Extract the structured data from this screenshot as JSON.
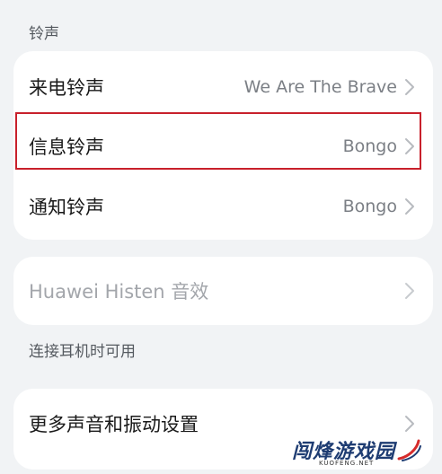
{
  "section_ringtone": {
    "label": "铃声"
  },
  "ringtones": [
    {
      "title": "来电铃声",
      "value": "We Are The Brave"
    },
    {
      "title": "信息铃声",
      "value": "Bongo"
    },
    {
      "title": "通知铃声",
      "value": "Bongo"
    }
  ],
  "histen": {
    "title": "Huawei Histen 音效",
    "disabled": true
  },
  "histen_note": {
    "label": "连接耳机时可用"
  },
  "more_settings": {
    "title": "更多声音和振动设置"
  },
  "watermark": {
    "text": "闯烽游戏园",
    "subtext": "KUOFENG.NET"
  },
  "colors": {
    "background": "#f1f3f5",
    "card": "#ffffff",
    "highlight": "#c8202b",
    "chevron": "#b8bbc0"
  },
  "icons": [
    "chevron-right-icon"
  ]
}
